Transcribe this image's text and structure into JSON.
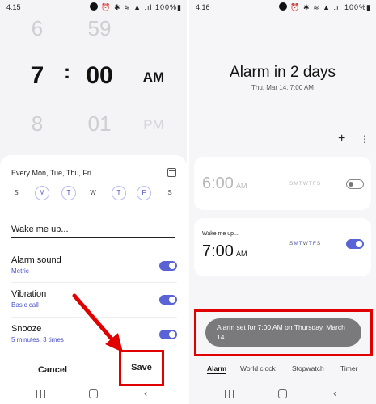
{
  "left": {
    "status": {
      "time": "4:15",
      "icons": "⏰ ✱ ≋ ▲ .ıl 100%▮"
    },
    "picker": {
      "hour_prev": "6",
      "hour": "7",
      "hour_next": "8",
      "separator": ":",
      "minute_prev": "59",
      "minute": "00",
      "minute_next": "01",
      "ampm": "AM",
      "ampm_next": "PM"
    },
    "repeat_text": "Every Mon, Tue, Thu, Fri",
    "days": [
      {
        "letter": "S",
        "selected": false
      },
      {
        "letter": "M",
        "selected": true
      },
      {
        "letter": "T",
        "selected": true
      },
      {
        "letter": "W",
        "selected": false
      },
      {
        "letter": "T",
        "selected": true
      },
      {
        "letter": "F",
        "selected": true
      },
      {
        "letter": "S",
        "selected": false
      }
    ],
    "alarm_name": "Wake me up...",
    "settings": [
      {
        "title": "Alarm sound",
        "sub": "Metric",
        "on": true
      },
      {
        "title": "Vibration",
        "sub": "Basic call",
        "on": true
      },
      {
        "title": "Snooze",
        "sub": "5 minutes, 3 times",
        "on": true
      }
    ],
    "cancel_label": "Cancel",
    "save_label": "Save"
  },
  "right": {
    "status": {
      "time": "4:16",
      "icons": "⏰ ✱ ≋ ▲ .ıl 100%▮"
    },
    "title": "Alarm in 2 days",
    "subtitle": "Thu, Mar 14, 7:00 AM",
    "alarms": [
      {
        "label": "",
        "time": "6:00",
        "ampm": "AM",
        "days": [
          "S",
          "M",
          "T",
          "W",
          "T",
          "F",
          "S"
        ],
        "on": false
      },
      {
        "label": "Wake me up...",
        "time": "7:00",
        "ampm": "AM",
        "days": [
          "S",
          "M",
          "T",
          "W",
          "T",
          "F",
          "S"
        ],
        "on": true
      }
    ],
    "toast": "Alarm set for 7:00 AM on Thursday, March 14.",
    "tabs": [
      {
        "label": "Alarm",
        "active": true
      },
      {
        "label": "World clock",
        "active": false
      },
      {
        "label": "Stopwatch",
        "active": false
      },
      {
        "label": "Timer",
        "active": false
      }
    ]
  },
  "colors": {
    "accent": "#5a63d6",
    "highlight": "#e10000",
    "toast_bg": "#7a7a7d"
  }
}
